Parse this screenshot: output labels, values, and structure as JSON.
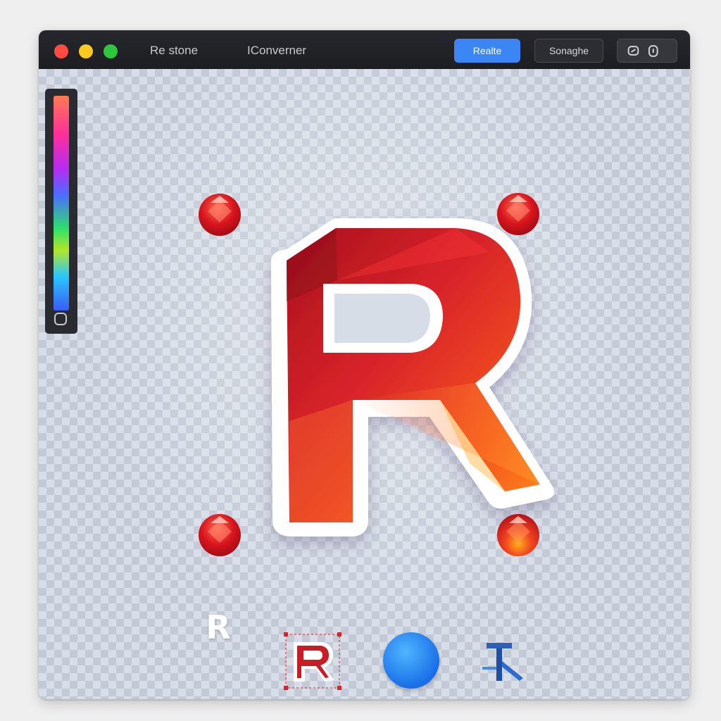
{
  "window": {
    "title_left": "Re stone",
    "title_right": "IConverner"
  },
  "toolbar": {
    "primary_label": "Realte",
    "secondary_label": "Sonaghe"
  },
  "canvas": {
    "main_glyph": "R"
  },
  "bottom_toolbar": {
    "plain_r_label": "R"
  },
  "colors": {
    "titlebar": "#1f2024",
    "primary_button": "#3b86f4",
    "logo_red": "#c81d24",
    "logo_orange": "#ff7a1a",
    "circle_blue": "#2f8df5"
  }
}
